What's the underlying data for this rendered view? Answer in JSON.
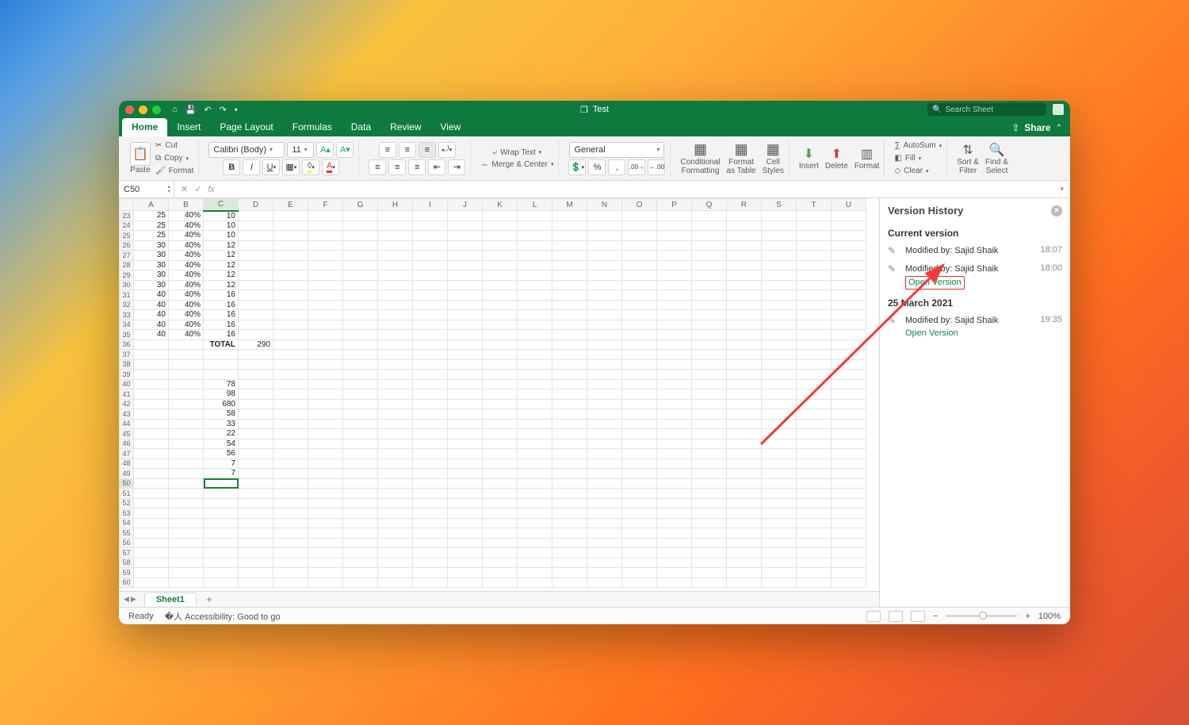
{
  "titlebar": {
    "doc_title": "Test",
    "search_placeholder": "Search Sheet"
  },
  "tabs": {
    "items": [
      "Home",
      "Insert",
      "Page Layout",
      "Formulas",
      "Data",
      "Review",
      "View"
    ],
    "active": 0,
    "share": "Share"
  },
  "ribbon": {
    "paste": "Paste",
    "cut": "Cut",
    "copy": "Copy",
    "format_painter": "Format",
    "font_name": "Calibri (Body)",
    "font_size": "11",
    "wrap": "Wrap Text",
    "merge": "Merge & Center",
    "number_format": "General",
    "cond_fmt": "Conditional\nFormatting",
    "fmt_table": "Format\nas Table",
    "cell_styles": "Cell\nStyles",
    "insert": "Insert",
    "delete": "Delete",
    "format": "Format",
    "autosum": "AutoSum",
    "fill": "Fill",
    "clear": "Clear",
    "sort": "Sort &\nFilter",
    "find": "Find &\nSelect"
  },
  "fx": {
    "name_box": "C50"
  },
  "grid": {
    "cols": [
      "A",
      "B",
      "C",
      "D",
      "E",
      "F",
      "G",
      "H",
      "I",
      "J",
      "K",
      "L",
      "M",
      "N",
      "O",
      "P",
      "Q",
      "R",
      "S",
      "T",
      "U"
    ],
    "first_row": 23,
    "active_cell_col": "C",
    "active_cell_row": 50,
    "rows": [
      {
        "r": 23,
        "A": "25",
        "B": "40%",
        "C": "10"
      },
      {
        "r": 24,
        "A": "25",
        "B": "40%",
        "C": "10"
      },
      {
        "r": 25,
        "A": "25",
        "B": "40%",
        "C": "10"
      },
      {
        "r": 26,
        "A": "30",
        "B": "40%",
        "C": "12"
      },
      {
        "r": 27,
        "A": "30",
        "B": "40%",
        "C": "12"
      },
      {
        "r": 28,
        "A": "30",
        "B": "40%",
        "C": "12"
      },
      {
        "r": 29,
        "A": "30",
        "B": "40%",
        "C": "12"
      },
      {
        "r": 30,
        "A": "30",
        "B": "40%",
        "C": "12"
      },
      {
        "r": 31,
        "A": "40",
        "B": "40%",
        "C": "16"
      },
      {
        "r": 32,
        "A": "40",
        "B": "40%",
        "C": "16"
      },
      {
        "r": 33,
        "A": "40",
        "B": "40%",
        "C": "16"
      },
      {
        "r": 34,
        "A": "40",
        "B": "40%",
        "C": "16"
      },
      {
        "r": 35,
        "A": "40",
        "B": "40%",
        "C": "16"
      },
      {
        "r": 36,
        "C": "TOTAL",
        "D": "290",
        "C_align": "right_bold"
      },
      {
        "r": 37
      },
      {
        "r": 38
      },
      {
        "r": 39
      },
      {
        "r": 40,
        "C": "78"
      },
      {
        "r": 41,
        "C": "98"
      },
      {
        "r": 42,
        "C": "680"
      },
      {
        "r": 43,
        "C": "58"
      },
      {
        "r": 44,
        "C": "33"
      },
      {
        "r": 45,
        "C": "22"
      },
      {
        "r": 46,
        "C": "54"
      },
      {
        "r": 47,
        "C": "56"
      },
      {
        "r": 48,
        "C": "7"
      },
      {
        "r": 49,
        "C": "7"
      },
      {
        "r": 50
      },
      {
        "r": 51
      },
      {
        "r": 52
      },
      {
        "r": 53
      },
      {
        "r": 54
      },
      {
        "r": 55
      },
      {
        "r": 56
      },
      {
        "r": 57
      },
      {
        "r": 58
      },
      {
        "r": 59
      },
      {
        "r": 60
      }
    ]
  },
  "sheets": {
    "active": "Sheet1"
  },
  "status": {
    "ready": "Ready",
    "accessibility": "Accessibility: Good to go",
    "zoom": "100%"
  },
  "version_history": {
    "title": "Version History",
    "current_label": "Current version",
    "entries_current": [
      {
        "by": "Modified by: Sajid Shaik",
        "time": "18:07"
      },
      {
        "by": "Modified by: Sajid Shaik",
        "time": "18:00",
        "open": "Open Version",
        "highlight": true
      }
    ],
    "date_label": "25 March 2021",
    "entries_past": [
      {
        "by": "Modified by: Sajid Shaik",
        "time": "19:35",
        "open": "Open Version"
      }
    ]
  }
}
